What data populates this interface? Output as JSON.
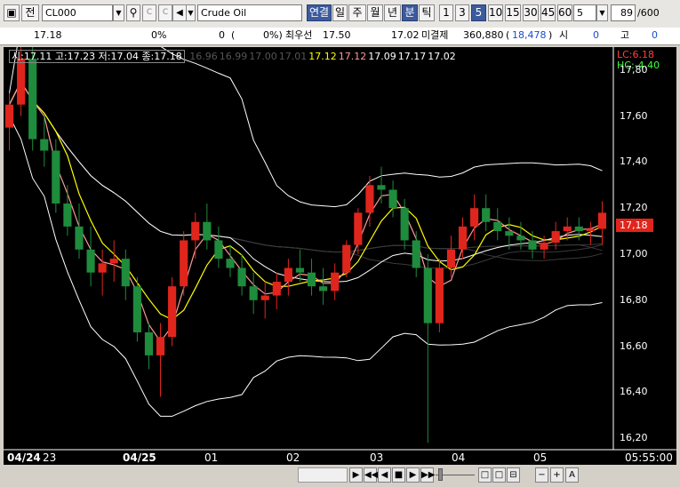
{
  "toolbar": {
    "jeon_label": "전",
    "symbol_value": "CL000",
    "product_name": "Crude Oil",
    "period_tabs": [
      "연결",
      "일",
      "주",
      "월",
      "년",
      "분",
      "틱"
    ],
    "active_period": "분",
    "interval_buttons": [
      "1",
      "3",
      "5",
      "10",
      "15",
      "30",
      "45",
      "60"
    ],
    "active_interval": "5",
    "interval_select": "5",
    "count_value": "89",
    "count_total": "/600"
  },
  "quote": {
    "price": "17.18",
    "change_pct": "0%",
    "volume": "0",
    "volume_paren": "(",
    "volume_pct": "0%)",
    "best_bid_label": "최우선",
    "best_bid": "17.50",
    "best_ask": "17.02",
    "open_interest_label": "미결제",
    "open_interest": "360,880",
    "open_interest_change": "18,478",
    "open_label": "시",
    "open_value": "0",
    "high_label": "고",
    "high_value": "0"
  },
  "chart": {
    "legend_ohlc": "시:17.11 고:17.23 저:17.04 종:17.18",
    "legend_ma_values": [
      "16.96",
      "16.99",
      "17.00",
      "17.01",
      "17.12",
      "17.12",
      "17.09",
      "17.17",
      "17.02"
    ],
    "legend_ma_colors": [
      "#555555",
      "#555555",
      "#555555",
      "#555555",
      "#ffff00",
      "#ff9999",
      "#ffffff",
      "#ffffff",
      "#ffffff"
    ],
    "lc_label": "LC:6.18",
    "hc_label": "HC:-4.40",
    "y_ticks": [
      "17,80",
      "17,60",
      "17,40",
      "17,20",
      "17,00",
      "16,80",
      "16,60",
      "16,40",
      "16,20"
    ],
    "current_price_label": "17,18",
    "x_labels": [
      "04/24",
      "23",
      "04/25",
      "01",
      "02",
      "03",
      "04",
      "05"
    ],
    "time_label": "05:55:00",
    "up_color": "#e0251c",
    "down_color": "#1e8c3c"
  },
  "chart_data": {
    "type": "candlestick",
    "y_range": [
      16.15,
      17.9
    ],
    "candles": [
      {
        "o": 17.55,
        "h": 17.7,
        "l": 17.45,
        "c": 17.65
      },
      {
        "o": 17.65,
        "h": 17.9,
        "l": 17.6,
        "c": 17.85
      },
      {
        "o": 17.85,
        "h": 17.9,
        "l": 17.45,
        "c": 17.5
      },
      {
        "o": 17.5,
        "h": 17.6,
        "l": 17.38,
        "c": 17.45
      },
      {
        "o": 17.45,
        "h": 17.5,
        "l": 17.18,
        "c": 17.22
      },
      {
        "o": 17.22,
        "h": 17.3,
        "l": 17.08,
        "c": 17.12
      },
      {
        "o": 17.12,
        "h": 17.22,
        "l": 16.98,
        "c": 17.02
      },
      {
        "o": 17.02,
        "h": 17.12,
        "l": 16.86,
        "c": 16.92
      },
      {
        "o": 16.92,
        "h": 17.02,
        "l": 16.82,
        "c": 16.96
      },
      {
        "o": 16.96,
        "h": 17.06,
        "l": 16.88,
        "c": 16.98
      },
      {
        "o": 16.98,
        "h": 17.02,
        "l": 16.8,
        "c": 16.86
      },
      {
        "o": 16.86,
        "h": 16.9,
        "l": 16.62,
        "c": 16.66
      },
      {
        "o": 16.66,
        "h": 16.7,
        "l": 16.5,
        "c": 16.56
      },
      {
        "o": 16.56,
        "h": 16.7,
        "l": 16.38,
        "c": 16.64
      },
      {
        "o": 16.64,
        "h": 16.9,
        "l": 16.6,
        "c": 16.86
      },
      {
        "o": 16.86,
        "h": 17.1,
        "l": 16.82,
        "c": 17.06
      },
      {
        "o": 17.06,
        "h": 17.18,
        "l": 16.98,
        "c": 17.14
      },
      {
        "o": 17.14,
        "h": 17.22,
        "l": 17.02,
        "c": 17.06
      },
      {
        "o": 17.06,
        "h": 17.12,
        "l": 16.94,
        "c": 16.98
      },
      {
        "o": 16.98,
        "h": 17.04,
        "l": 16.9,
        "c": 16.94
      },
      {
        "o": 16.94,
        "h": 17.0,
        "l": 16.82,
        "c": 16.86
      },
      {
        "o": 16.86,
        "h": 16.92,
        "l": 16.74,
        "c": 16.8
      },
      {
        "o": 16.8,
        "h": 16.88,
        "l": 16.72,
        "c": 16.82
      },
      {
        "o": 16.82,
        "h": 16.92,
        "l": 16.76,
        "c": 16.88
      },
      {
        "o": 16.88,
        "h": 16.98,
        "l": 16.82,
        "c": 16.94
      },
      {
        "o": 16.94,
        "h": 17.02,
        "l": 16.88,
        "c": 16.92
      },
      {
        "o": 16.92,
        "h": 16.98,
        "l": 16.82,
        "c": 16.86
      },
      {
        "o": 16.86,
        "h": 16.94,
        "l": 16.78,
        "c": 16.84
      },
      {
        "o": 16.84,
        "h": 16.96,
        "l": 16.8,
        "c": 16.92
      },
      {
        "o": 16.92,
        "h": 17.06,
        "l": 16.9,
        "c": 17.04
      },
      {
        "o": 17.04,
        "h": 17.2,
        "l": 17.0,
        "c": 17.18
      },
      {
        "o": 17.18,
        "h": 17.34,
        "l": 17.12,
        "c": 17.3
      },
      {
        "o": 17.3,
        "h": 17.38,
        "l": 17.22,
        "c": 17.28
      },
      {
        "o": 17.28,
        "h": 17.32,
        "l": 17.16,
        "c": 17.2
      },
      {
        "o": 17.2,
        "h": 17.24,
        "l": 17.02,
        "c": 17.06
      },
      {
        "o": 17.06,
        "h": 17.1,
        "l": 16.9,
        "c": 16.94
      },
      {
        "o": 16.94,
        "h": 17.0,
        "l": 16.18,
        "c": 16.7
      },
      {
        "o": 16.7,
        "h": 16.98,
        "l": 16.66,
        "c": 16.94
      },
      {
        "o": 16.94,
        "h": 17.08,
        "l": 16.9,
        "c": 17.02
      },
      {
        "o": 17.02,
        "h": 17.16,
        "l": 16.98,
        "c": 17.12
      },
      {
        "o": 17.12,
        "h": 17.26,
        "l": 17.06,
        "c": 17.2
      },
      {
        "o": 17.2,
        "h": 17.26,
        "l": 17.1,
        "c": 17.14
      },
      {
        "o": 17.14,
        "h": 17.2,
        "l": 17.06,
        "c": 17.1
      },
      {
        "o": 17.1,
        "h": 17.16,
        "l": 17.02,
        "c": 17.08
      },
      {
        "o": 17.08,
        "h": 17.14,
        "l": 17.02,
        "c": 17.06
      },
      {
        "o": 17.06,
        "h": 17.1,
        "l": 16.98,
        "c": 17.02
      },
      {
        "o": 17.02,
        "h": 17.08,
        "l": 16.98,
        "c": 17.05
      },
      {
        "o": 17.05,
        "h": 17.14,
        "l": 17.02,
        "c": 17.1
      },
      {
        "o": 17.1,
        "h": 17.16,
        "l": 17.06,
        "c": 17.12
      },
      {
        "o": 17.12,
        "h": 17.16,
        "l": 17.06,
        "c": 17.1
      },
      {
        "o": 17.1,
        "h": 17.14,
        "l": 17.04,
        "c": 17.11
      },
      {
        "o": 17.11,
        "h": 17.23,
        "l": 17.04,
        "c": 17.18
      }
    ]
  },
  "bottom": {
    "buttons": [
      "▶",
      "◀◀",
      "◀",
      "■",
      "▶",
      "▶▶",
      "□",
      "□",
      "⊟",
      "−",
      "+",
      "A"
    ]
  }
}
